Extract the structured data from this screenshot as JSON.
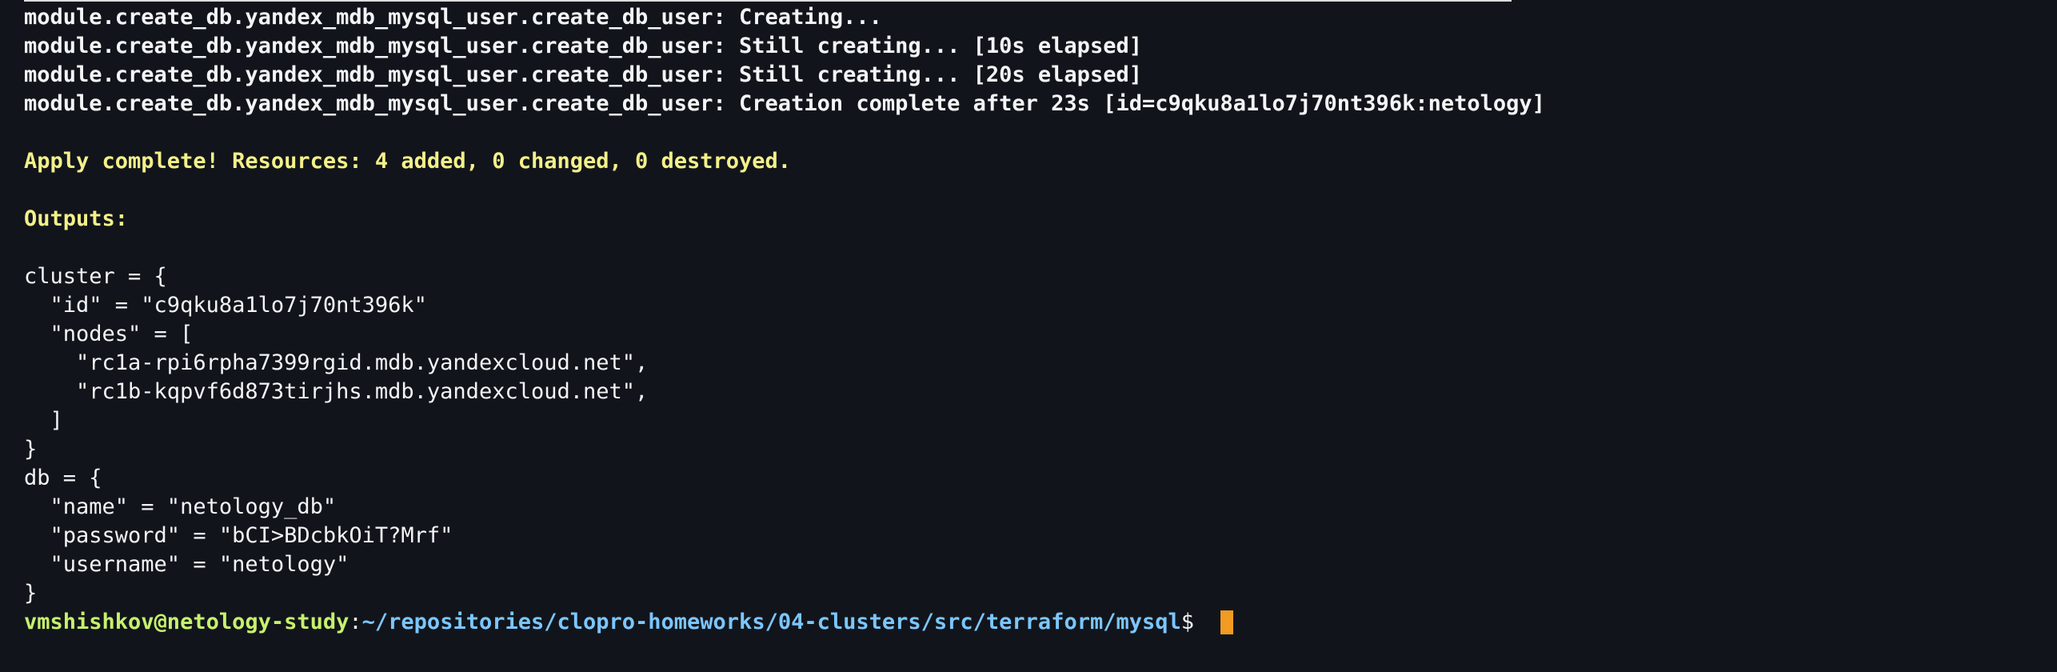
{
  "terminal": {
    "output_lines": [
      "module.create_db.yandex_mdb_mysql_user.create_db_user: Creating...",
      "module.create_db.yandex_mdb_mysql_user.create_db_user: Still creating... [10s elapsed]",
      "module.create_db.yandex_mdb_mysql_user.create_db_user: Still creating... [20s elapsed]",
      "module.create_db.yandex_mdb_mysql_user.create_db_user: Creation complete after 23s [id=c9qku8a1lo7j70nt396k:netology]",
      "",
      "Apply complete! Resources: 4 added, 0 changed, 0 destroyed.",
      "",
      "Outputs:",
      "",
      "cluster = {",
      "  \"id\" = \"c9qku8a1lo7j70nt396k\"",
      "  \"nodes\" = [",
      "    \"rc1a-rpi6rpha7399rgid.mdb.yandexcloud.net\",",
      "    \"rc1b-kqpvf6d873tirjhs.mdb.yandexcloud.net\",",
      "  ]",
      "}",
      "db = {",
      "  \"name\" = \"netology_db\"",
      "  \"password\" = \"bCI>BDcbkOiT?Mrf\"",
      "  \"username\" = \"netology\"",
      "}"
    ],
    "prompt": {
      "user_host": "vmshishkov@netology-study",
      "separator": ":",
      "path": "~/repositories/clopro-homeworks/04-clusters/src/terraform/mysql",
      "symbol": "$ "
    }
  },
  "colors": {
    "background": "#11151b",
    "text": "#f3f4f6",
    "success": "#f4f08a",
    "prompt_user": "#c7f16d",
    "prompt_path": "#7cc6ff",
    "cursor": "#f19b22"
  }
}
